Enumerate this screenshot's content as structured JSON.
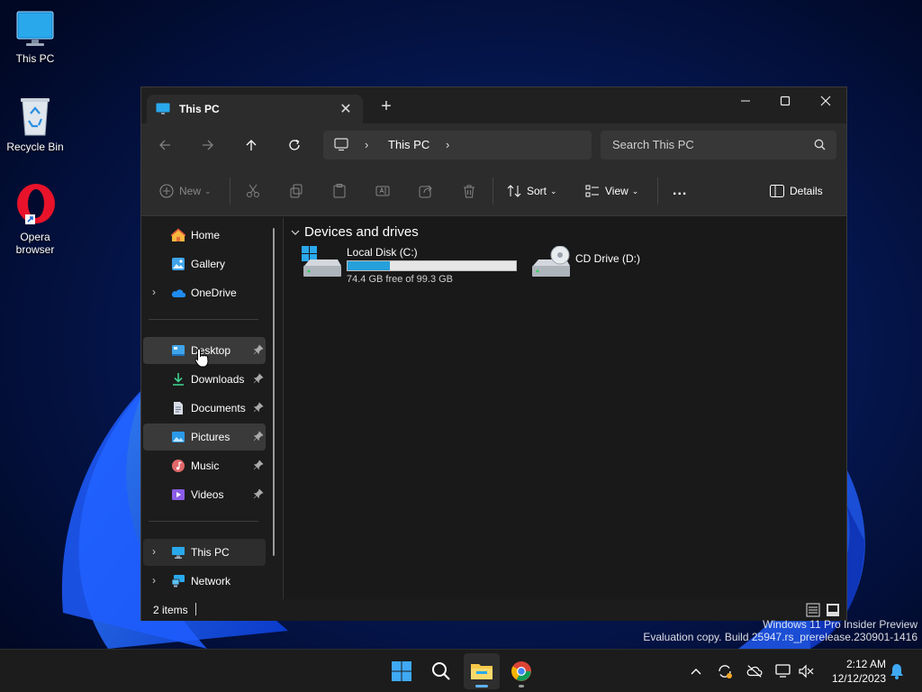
{
  "desktop": {
    "icons": [
      {
        "label": "This PC"
      },
      {
        "label": "Recycle Bin"
      },
      {
        "label": "Opera\nbrowser"
      }
    ]
  },
  "window": {
    "tab_title": "This PC",
    "address": {
      "segment": "This PC"
    },
    "search": {
      "placeholder": "Search This PC"
    },
    "commands": {
      "new": "New",
      "sort": "Sort",
      "view": "View",
      "more": "...",
      "details": "Details"
    }
  },
  "sidebar": {
    "items": [
      {
        "label": "Home",
        "icon": "home-icon"
      },
      {
        "label": "Gallery",
        "icon": "gallery-icon"
      },
      {
        "label": "OneDrive",
        "icon": "onedrive-icon",
        "expandable": true
      },
      {
        "label": "Desktop",
        "icon": "desktop-folder-icon",
        "pinned": true
      },
      {
        "label": "Downloads",
        "icon": "downloads-icon",
        "pinned": true
      },
      {
        "label": "Documents",
        "icon": "documents-icon",
        "pinned": true
      },
      {
        "label": "Pictures",
        "icon": "pictures-icon",
        "pinned": true
      },
      {
        "label": "Music",
        "icon": "music-icon",
        "pinned": true
      },
      {
        "label": "Videos",
        "icon": "videos-icon",
        "pinned": true
      },
      {
        "label": "This PC",
        "icon": "this-pc-icon",
        "expandable": true,
        "selected": true
      },
      {
        "label": "Network",
        "icon": "network-icon",
        "expandable": true
      }
    ]
  },
  "content": {
    "group_title": "Devices and drives",
    "drives": [
      {
        "name": "Local Disk (C:)",
        "free_text": "74.4 GB free of 99.3 GB",
        "used_fraction": 0.25
      },
      {
        "name": "CD Drive (D:)"
      }
    ]
  },
  "statusbar": {
    "item_count": "2 items"
  },
  "watermark": {
    "line1": "Windows 11 Pro Insider Preview",
    "line2": "Evaluation copy. Build 25947.rs_prerelease.230901-1416"
  },
  "taskbar": {
    "clock": {
      "time": "2:12 AM",
      "date": "12/12/2023"
    }
  },
  "colors": {
    "accent": "#26a0da",
    "window_bg": "#191919",
    "toolbar_bg": "#2c2c2c"
  }
}
